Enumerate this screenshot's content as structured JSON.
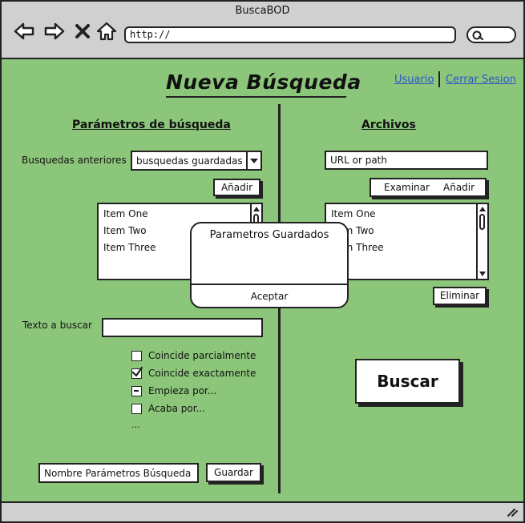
{
  "window": {
    "title": "BuscaBOD"
  },
  "browser": {
    "url_value": "http://",
    "icons": [
      "back-arrow-icon",
      "forward-arrow-icon",
      "close-x-icon",
      "home-icon",
      "search-icon"
    ]
  },
  "header": {
    "title": "Nueva Búsqueda",
    "links": {
      "usuario": "Usuario",
      "cerrar_sesion": "Cerrar Sesion"
    }
  },
  "left": {
    "heading": "Parámetros de búsqueda",
    "previous_label": "Busquedas anteriores",
    "previous_selected": "busquedas guardadas",
    "add_label": "Añadir",
    "list_items": [
      "Item One",
      "Item Two",
      "Item Three"
    ],
    "search_text_label": "Texto a buscar",
    "search_text_value": "",
    "options": [
      {
        "label": "Coincide parcialmente",
        "state": "unchecked"
      },
      {
        "label": "Coincide exactamente",
        "state": "checked"
      },
      {
        "label": "Empieza por...",
        "state": "indeterminate"
      },
      {
        "label": "Acaba por...",
        "state": "unchecked"
      }
    ],
    "more_options": "...",
    "params_name_value": "Nombre Parámetros Búsqueda",
    "save_label": "Guardar"
  },
  "right": {
    "heading": "Archivos",
    "url_field_value": "URL or path",
    "browse_label": "Examinar",
    "add_label": "Añadir",
    "list_items": [
      "Item One",
      "Item Two",
      "Item Three"
    ],
    "delete_label": "Eliminar",
    "search_button_label": "Buscar"
  },
  "modal": {
    "title": "Parametros Guardados",
    "accept_label": "Aceptar"
  },
  "colors": {
    "page_background": "#8cc67a",
    "chrome_background": "#d0d0d0",
    "link": "#2a55c8",
    "outline": "#222222"
  }
}
